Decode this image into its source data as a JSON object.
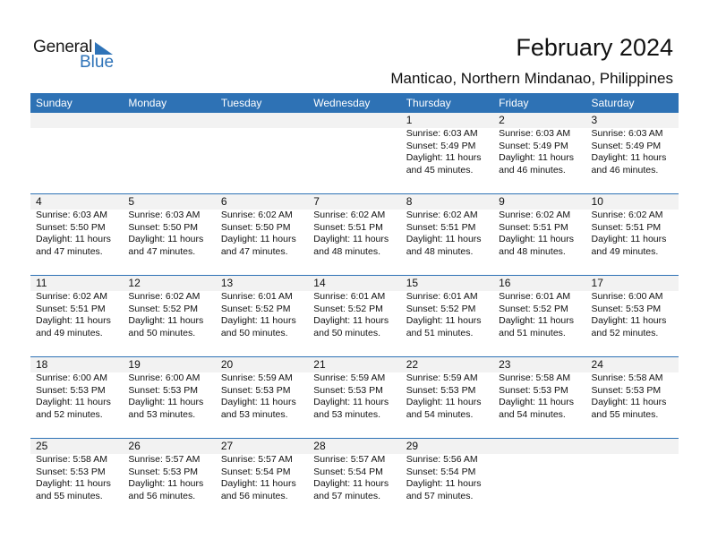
{
  "logo": {
    "line1": "General",
    "line2": "Blue"
  },
  "header": {
    "title": "February 2024",
    "location": "Manticao, Northern Mindanao, Philippines"
  },
  "colors": {
    "accent": "#2e72b5",
    "band": "#f2f2f2"
  },
  "weekdays": [
    "Sunday",
    "Monday",
    "Tuesday",
    "Wednesday",
    "Thursday",
    "Friday",
    "Saturday"
  ],
  "weeks": [
    [
      null,
      null,
      null,
      null,
      {
        "day": "1",
        "sunrise": "Sunrise: 6:03 AM",
        "sunset": "Sunset: 5:49 PM",
        "daylight1": "Daylight: 11 hours",
        "daylight2": "and 45 minutes."
      },
      {
        "day": "2",
        "sunrise": "Sunrise: 6:03 AM",
        "sunset": "Sunset: 5:49 PM",
        "daylight1": "Daylight: 11 hours",
        "daylight2": "and 46 minutes."
      },
      {
        "day": "3",
        "sunrise": "Sunrise: 6:03 AM",
        "sunset": "Sunset: 5:49 PM",
        "daylight1": "Daylight: 11 hours",
        "daylight2": "and 46 minutes."
      }
    ],
    [
      {
        "day": "4",
        "sunrise": "Sunrise: 6:03 AM",
        "sunset": "Sunset: 5:50 PM",
        "daylight1": "Daylight: 11 hours",
        "daylight2": "and 47 minutes."
      },
      {
        "day": "5",
        "sunrise": "Sunrise: 6:03 AM",
        "sunset": "Sunset: 5:50 PM",
        "daylight1": "Daylight: 11 hours",
        "daylight2": "and 47 minutes."
      },
      {
        "day": "6",
        "sunrise": "Sunrise: 6:02 AM",
        "sunset": "Sunset: 5:50 PM",
        "daylight1": "Daylight: 11 hours",
        "daylight2": "and 47 minutes."
      },
      {
        "day": "7",
        "sunrise": "Sunrise: 6:02 AM",
        "sunset": "Sunset: 5:51 PM",
        "daylight1": "Daylight: 11 hours",
        "daylight2": "and 48 minutes."
      },
      {
        "day": "8",
        "sunrise": "Sunrise: 6:02 AM",
        "sunset": "Sunset: 5:51 PM",
        "daylight1": "Daylight: 11 hours",
        "daylight2": "and 48 minutes."
      },
      {
        "day": "9",
        "sunrise": "Sunrise: 6:02 AM",
        "sunset": "Sunset: 5:51 PM",
        "daylight1": "Daylight: 11 hours",
        "daylight2": "and 48 minutes."
      },
      {
        "day": "10",
        "sunrise": "Sunrise: 6:02 AM",
        "sunset": "Sunset: 5:51 PM",
        "daylight1": "Daylight: 11 hours",
        "daylight2": "and 49 minutes."
      }
    ],
    [
      {
        "day": "11",
        "sunrise": "Sunrise: 6:02 AM",
        "sunset": "Sunset: 5:51 PM",
        "daylight1": "Daylight: 11 hours",
        "daylight2": "and 49 minutes."
      },
      {
        "day": "12",
        "sunrise": "Sunrise: 6:02 AM",
        "sunset": "Sunset: 5:52 PM",
        "daylight1": "Daylight: 11 hours",
        "daylight2": "and 50 minutes."
      },
      {
        "day": "13",
        "sunrise": "Sunrise: 6:01 AM",
        "sunset": "Sunset: 5:52 PM",
        "daylight1": "Daylight: 11 hours",
        "daylight2": "and 50 minutes."
      },
      {
        "day": "14",
        "sunrise": "Sunrise: 6:01 AM",
        "sunset": "Sunset: 5:52 PM",
        "daylight1": "Daylight: 11 hours",
        "daylight2": "and 50 minutes."
      },
      {
        "day": "15",
        "sunrise": "Sunrise: 6:01 AM",
        "sunset": "Sunset: 5:52 PM",
        "daylight1": "Daylight: 11 hours",
        "daylight2": "and 51 minutes."
      },
      {
        "day": "16",
        "sunrise": "Sunrise: 6:01 AM",
        "sunset": "Sunset: 5:52 PM",
        "daylight1": "Daylight: 11 hours",
        "daylight2": "and 51 minutes."
      },
      {
        "day": "17",
        "sunrise": "Sunrise: 6:00 AM",
        "sunset": "Sunset: 5:53 PM",
        "daylight1": "Daylight: 11 hours",
        "daylight2": "and 52 minutes."
      }
    ],
    [
      {
        "day": "18",
        "sunrise": "Sunrise: 6:00 AM",
        "sunset": "Sunset: 5:53 PM",
        "daylight1": "Daylight: 11 hours",
        "daylight2": "and 52 minutes."
      },
      {
        "day": "19",
        "sunrise": "Sunrise: 6:00 AM",
        "sunset": "Sunset: 5:53 PM",
        "daylight1": "Daylight: 11 hours",
        "daylight2": "and 53 minutes."
      },
      {
        "day": "20",
        "sunrise": "Sunrise: 5:59 AM",
        "sunset": "Sunset: 5:53 PM",
        "daylight1": "Daylight: 11 hours",
        "daylight2": "and 53 minutes."
      },
      {
        "day": "21",
        "sunrise": "Sunrise: 5:59 AM",
        "sunset": "Sunset: 5:53 PM",
        "daylight1": "Daylight: 11 hours",
        "daylight2": "and 53 minutes."
      },
      {
        "day": "22",
        "sunrise": "Sunrise: 5:59 AM",
        "sunset": "Sunset: 5:53 PM",
        "daylight1": "Daylight: 11 hours",
        "daylight2": "and 54 minutes."
      },
      {
        "day": "23",
        "sunrise": "Sunrise: 5:58 AM",
        "sunset": "Sunset: 5:53 PM",
        "daylight1": "Daylight: 11 hours",
        "daylight2": "and 54 minutes."
      },
      {
        "day": "24",
        "sunrise": "Sunrise: 5:58 AM",
        "sunset": "Sunset: 5:53 PM",
        "daylight1": "Daylight: 11 hours",
        "daylight2": "and 55 minutes."
      }
    ],
    [
      {
        "day": "25",
        "sunrise": "Sunrise: 5:58 AM",
        "sunset": "Sunset: 5:53 PM",
        "daylight1": "Daylight: 11 hours",
        "daylight2": "and 55 minutes."
      },
      {
        "day": "26",
        "sunrise": "Sunrise: 5:57 AM",
        "sunset": "Sunset: 5:53 PM",
        "daylight1": "Daylight: 11 hours",
        "daylight2": "and 56 minutes."
      },
      {
        "day": "27",
        "sunrise": "Sunrise: 5:57 AM",
        "sunset": "Sunset: 5:54 PM",
        "daylight1": "Daylight: 11 hours",
        "daylight2": "and 56 minutes."
      },
      {
        "day": "28",
        "sunrise": "Sunrise: 5:57 AM",
        "sunset": "Sunset: 5:54 PM",
        "daylight1": "Daylight: 11 hours",
        "daylight2": "and 57 minutes."
      },
      {
        "day": "29",
        "sunrise": "Sunrise: 5:56 AM",
        "sunset": "Sunset: 5:54 PM",
        "daylight1": "Daylight: 11 hours",
        "daylight2": "and 57 minutes."
      },
      null,
      null
    ]
  ]
}
